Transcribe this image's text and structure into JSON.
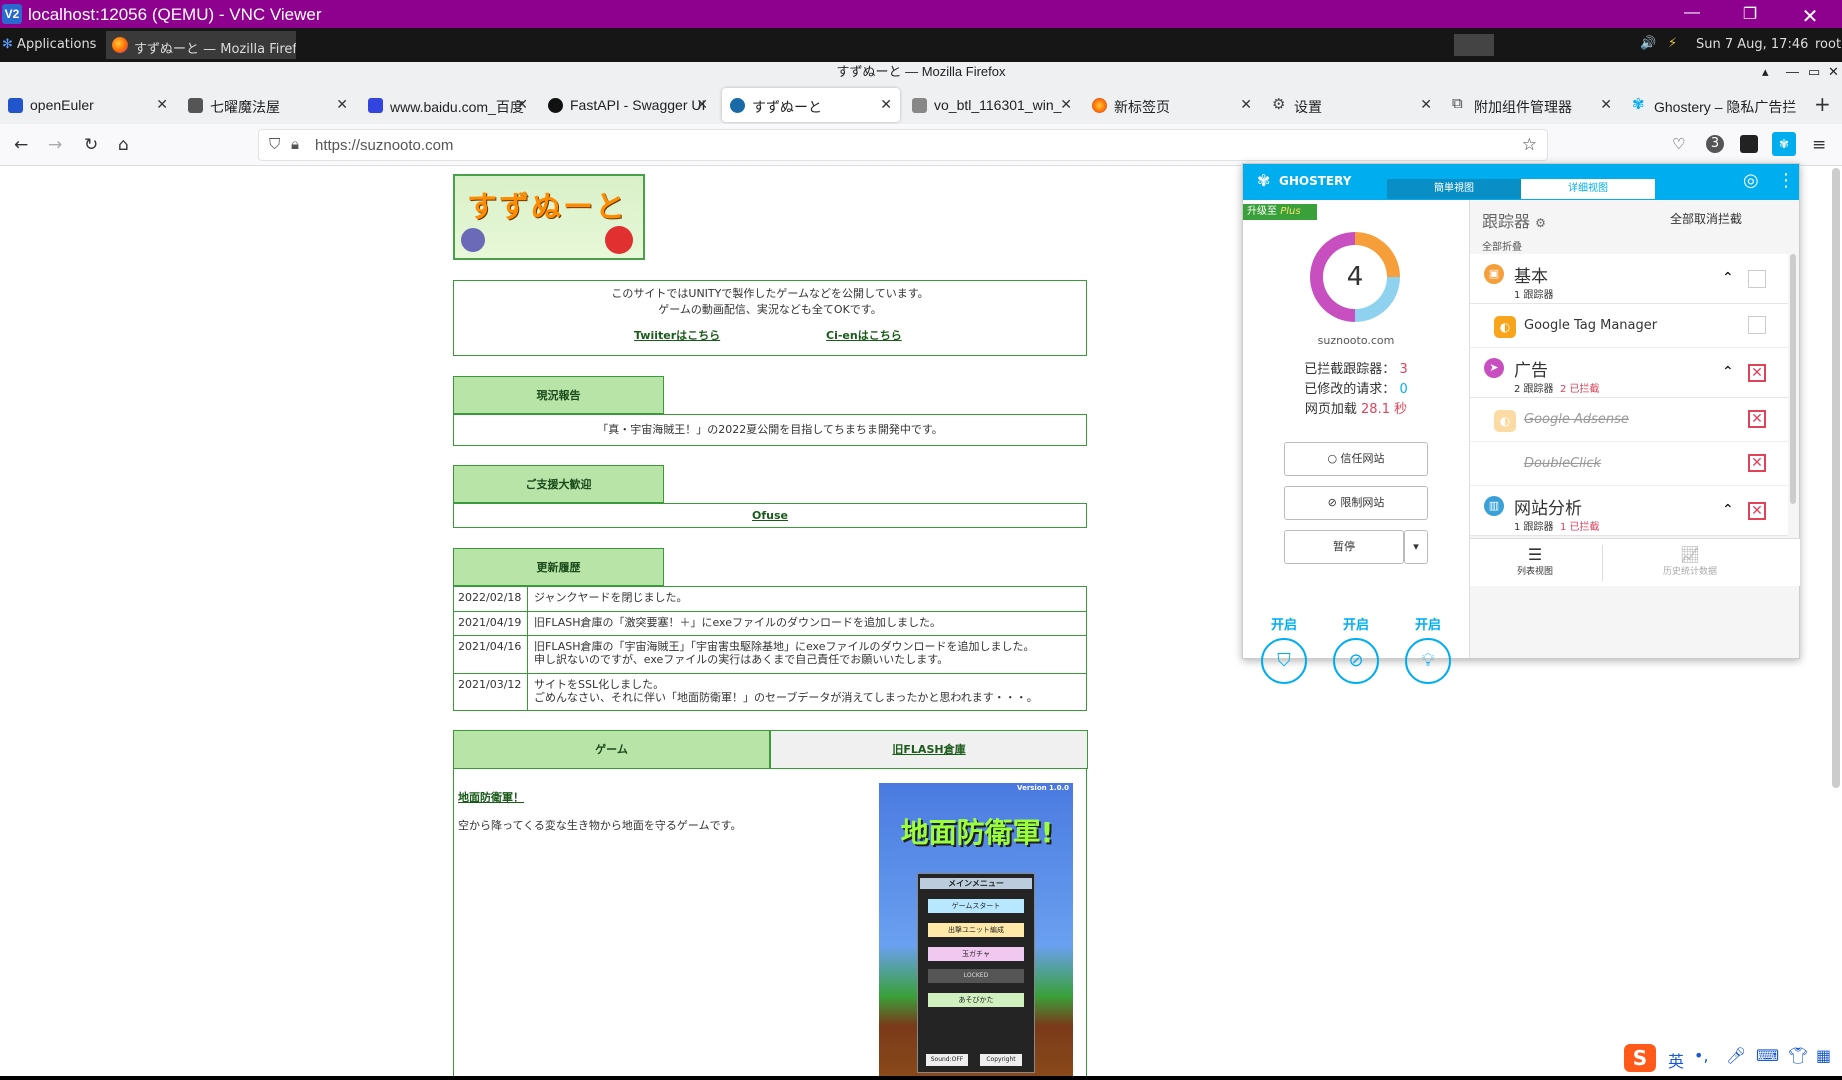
{
  "vnc": {
    "title": "localhost:12056 (QEMU) - VNC Viewer",
    "icon_text": "V2"
  },
  "panel": {
    "applications": "Applications",
    "task": "すずぬーと — Mozilla Firef...",
    "clock": "Sun  7 Aug, 17:46",
    "user": "root"
  },
  "firefox": {
    "window_title": "すずぬーと — Mozilla Firefox",
    "url": "https://suznooto.com"
  },
  "tabs": [
    {
      "label": "openEuler",
      "icon": "openeuler-icon",
      "color": "#2255cc"
    },
    {
      "label": "七曜魔法屋",
      "icon": "nanayou-icon",
      "color": "#444"
    },
    {
      "label": "www.baidu.com_百度",
      "icon": "baidu-icon",
      "color": "#3245df"
    },
    {
      "label": "FastAPI - Swagger UI",
      "icon": "fastapi-icon",
      "color": "#111"
    },
    {
      "label": "すずぬーと",
      "icon": "suzunuuto-icon",
      "color": "#1a6aa8"
    },
    {
      "label": "vo_btl_116301_win_",
      "icon": "speaker-icon",
      "color": "#666"
    },
    {
      "label": "新标签页",
      "icon": "firefox-icon",
      "color": "#ff6a00"
    },
    {
      "label": "设置",
      "icon": "gear-icon",
      "color": "#444"
    },
    {
      "label": "附加组件管理器",
      "icon": "puzzle-icon",
      "color": "#444"
    },
    {
      "label": "Ghostery – 隐私广告拦",
      "icon": "ghostery-icon",
      "color": "#00aef0"
    }
  ],
  "site": {
    "logo_text": "すずぬーと",
    "intro_line1": "このサイトではUNITYで製作したゲームなどを公開しています。",
    "intro_line2": "ゲームの動画配信、実況なども全てOKです。",
    "twitter_link": "Twiiterはこちら",
    "cien_link": "Ci-enはこちら",
    "status_header": "現況報告",
    "status_text": "「真・宇宙海賊王！」の2022夏公開を目指してちまちま開発中です。",
    "support_header": "ご支援大歓迎",
    "support_link": "Ofuse",
    "history_header": "更新履歴",
    "history": [
      {
        "date": "2022/02/18",
        "text": "ジャンクヤードを閉じました。",
        "text2": ""
      },
      {
        "date": "2021/04/19",
        "text": "旧FLASH倉庫の「激突要塞！＋」にexeファイルのダウンロードを追加しました。",
        "text2": ""
      },
      {
        "date": "2021/04/16",
        "text": "旧FLASH倉庫の「宇宙海賊王」「宇宙害虫駆除基地」にexeファイルのダウンロードを追加しました。",
        "text2": "申し訳ないのですが、exeファイルの実行はあくまで自己責任でお願いいたします。"
      },
      {
        "date": "2021/03/12",
        "text": "サイトをSSL化しました。",
        "text2": "ごめんなさい、それに伴い「地面防衛軍！」のセーブデータが消えてしまったかと思われます・・・。"
      }
    ],
    "tab_game": "ゲーム",
    "tab_flash": "旧FLASH倉庫",
    "game_title": "地面防衛軍！",
    "game_desc": "空から降ってくる変な生き物から地面を守るゲームです。",
    "game_shot": {
      "version": "Version 1.0.0",
      "title": "地面防衛軍!",
      "menu": "メインメニュー",
      "start": "ゲームスタート",
      "unit": "出撃ユニット編成",
      "gacha": "玉ガチャ",
      "locked": "LOCKED",
      "howto": "あそびかた",
      "sound": "Sound:OFF",
      "copyright": "Copyright"
    }
  },
  "ghostery": {
    "brand": "GHOSTERY",
    "tab_simple": "簡単視图",
    "tab_detail": "详细视图",
    "upgrade": "升级至",
    "plus": "Plus",
    "count": "4",
    "domain": "suznooto.com",
    "blocked_label": "已拦截跟踪器：",
    "blocked_val": "3",
    "modified_label": "已修改的请求：",
    "modified_val": "0",
    "load_label": "网页加载",
    "load_val": "28.1 秒",
    "trust": "信任网站",
    "restrict": "限制网站",
    "pause": "暂停",
    "on1": "开启",
    "on2": "开启",
    "on3": "开启",
    "trackers_title": "跟踪器",
    "unblock_all": "全部取消拦截",
    "collapse_all": "全部折叠",
    "categories": [
      {
        "name": "基本",
        "count": "1 跟踪器",
        "blocked": "",
        "color": "#f59e3a"
      },
      {
        "name": "广告",
        "count": "2 跟踪器",
        "blocked": "2 已拦截",
        "color": "#c84fc0"
      },
      {
        "name": "网站分析",
        "count": "1 跟踪器",
        "blocked": "1 已拦截",
        "color": "#3aa0d8"
      }
    ],
    "trackers": [
      "Google Tag Manager",
      "Google Adsense",
      "DoubleClick"
    ],
    "list_view": "列表视图",
    "history_view": "历史统计数据"
  },
  "ime": {
    "lang": "英"
  }
}
